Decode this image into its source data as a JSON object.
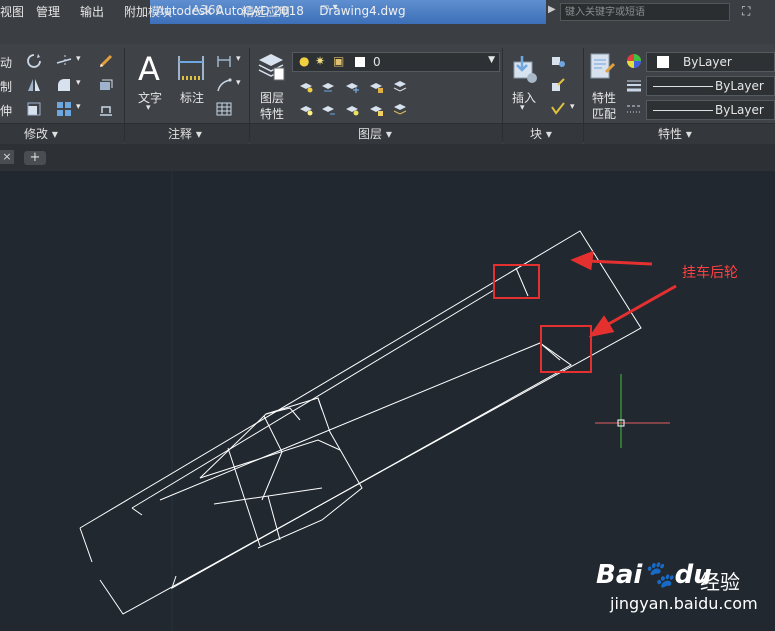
{
  "titlebar": {
    "app_title": "Autodesk AutoCAD 2018",
    "file_name": "Drawing4.dwg",
    "search_placeholder": "键入关键字或短语"
  },
  "menu": {
    "items": [
      "视图",
      "管理",
      "输出",
      "附加模块",
      "A360",
      "精选应用"
    ]
  },
  "ribbon": {
    "modify": {
      "label": "修改",
      "tools": [
        "移动",
        "复制",
        "拉伸"
      ]
    },
    "annotation": {
      "label": "注释",
      "text_label": "文字",
      "dim_label": "标注"
    },
    "layers": {
      "label": "图层",
      "props_label_1": "图层",
      "props_label_2": "特性",
      "current_layer": "0"
    },
    "block": {
      "label": "块",
      "insert_label": "插入"
    },
    "properties": {
      "label": "特性",
      "match_label_1": "特性",
      "match_label_2": "匹配",
      "color_value": "ByLayer",
      "linetype_value": "ByLayer",
      "lineweight_value": "ByLayer"
    }
  },
  "tabs": {
    "close_symbol": "×",
    "new_tab_symbol": "+"
  },
  "drawing": {
    "annotation_text": "挂车后轮",
    "line_color": "#ffffff",
    "highlight_color": "#e53030",
    "crosshair_x_color": "#e06060",
    "crosshair_y_color": "#40c040"
  },
  "watermark": {
    "brand": "Bai",
    "brand_suffix": "du",
    "product": "经验",
    "url": "jingyan.baidu.com"
  }
}
